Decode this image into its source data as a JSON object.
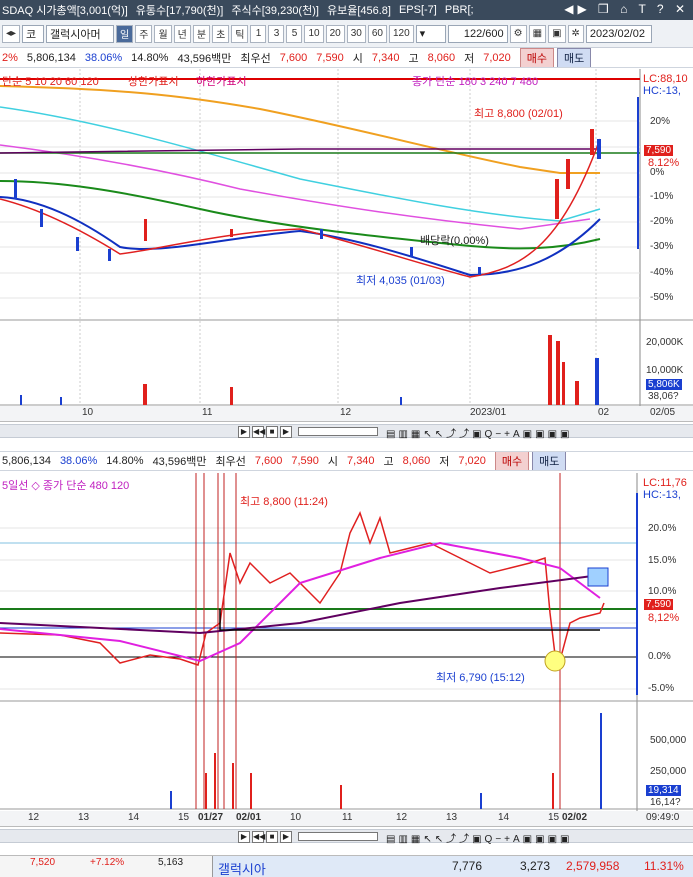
{
  "topbar": {
    "items": [
      "SDAQ 시가총액[3,001(억)]",
      "유통수[17,790(천)]",
      "주식수[39,230(천)]",
      "유보율[456.8]",
      "EPS[-7]",
      "PBR[;"
    ]
  },
  "toolbar": {
    "stock_prefix": "코",
    "stock_name": "갤럭시아머",
    "periods": [
      "일",
      "주",
      "월",
      "년",
      "분",
      "초",
      "틱"
    ],
    "minutes": [
      "1",
      "3",
      "5",
      "10",
      "20",
      "30",
      "60",
      "120"
    ],
    "count": "122/600",
    "date": "2023/02/02"
  },
  "info1": {
    "pct_left": "2%",
    "volume": "5,806,134",
    "ratio": "38.06%",
    "turnover": "14.80%",
    "amount": "43,596백만",
    "best_label": "최우선",
    "best_ask": "7,600",
    "best_bid": "7,590",
    "open_label": "시",
    "open": "7,340",
    "high_label": "고",
    "high": "8,060",
    "low_label": "저",
    "low": "7,020",
    "buy": "매수",
    "sell": "매도"
  },
  "chart1": {
    "legend_left": "단순 5 10 20 60 120",
    "legend_upper": "상한가표시",
    "legend_lower": "하한가표시",
    "legend_right": "종가 단순 180  3 240  7 480",
    "lc": "LC:88,10",
    "hc": "HC:-13,",
    "high_note": "최고 8,800 (02/01)",
    "low_note": "최저 4,035 (01/03)",
    "div_note": "배당락(0.00%)",
    "price_box": "7,590",
    "pct_box": "8.12%",
    "y_ticks": [
      "20%",
      "10%",
      "0%",
      "-10%",
      "-20%",
      "-30%",
      "-40%",
      "-50%"
    ],
    "vol_ticks": [
      "20,000K",
      "10,000K"
    ],
    "vol_box": "5,806K",
    "vol_last": "38,06?",
    "x_ticks": [
      "10",
      "11",
      "12",
      "2023/01",
      "02"
    ],
    "x_right": "02/05"
  },
  "info2": {
    "volume": "5,806,134",
    "ratio": "38.06%",
    "turnover": "14.80%",
    "amount": "43,596백만",
    "best_label": "최우선",
    "best_ask": "7,600",
    "best_bid": "7,590",
    "open_label": "시",
    "open": "7,340",
    "high_label": "고",
    "high": "8,060",
    "low_label": "저",
    "low": "7,020",
    "buy": "매수",
    "sell": "매도"
  },
  "chart2": {
    "legend": "5일선 ◇ 종가 단순 480  120",
    "lc": "LC:11,76",
    "hc": "HC:-13,",
    "high_note": "최고 8,800 (11:24)",
    "low_note": "최저 6,790 (15:12)",
    "price_box": "7,590",
    "pct_box": "8,12%",
    "y_ticks": [
      "20.0%",
      "15.0%",
      "10.0%",
      "5.0%",
      "0.0%",
      "-5.0%"
    ],
    "vol_ticks": [
      "500,000",
      "250,000"
    ],
    "vol_box": "19,314",
    "vol_last": "16,14?",
    "x_ticks": [
      "12",
      "13",
      "14",
      "15",
      "01/27",
      "02/01",
      "10",
      "11",
      "12",
      "13",
      "14",
      "15",
      "02/02"
    ],
    "x_right": "09:49:0"
  },
  "bottom": {
    "left_vals": [
      "7,520",
      "+7.12%",
      "5,163"
    ],
    "name": "갤럭시아",
    "v1": "7,776",
    "v2": "3,273",
    "v3": "2,579,958",
    "v4": "11.31%"
  },
  "chart_data": [
    {
      "type": "line",
      "title": "",
      "x": [
        "10",
        "11",
        "12",
        "2023/01",
        "02"
      ],
      "series": [
        {
          "name": "종가",
          "values": [
            -12,
            -28,
            -24,
            -38,
            12
          ]
        }
      ],
      "ylim": [
        -50,
        25
      ]
    },
    {
      "type": "line",
      "title": "",
      "x": [
        "12",
        "13",
        "14",
        "15",
        "01/27",
        "02/01",
        "02/02"
      ],
      "series": [
        {
          "name": "종가",
          "values": [
            3,
            0,
            0,
            -1,
            14,
            15,
            8
          ]
        }
      ],
      "ylim": [
        -5,
        22
      ]
    }
  ]
}
